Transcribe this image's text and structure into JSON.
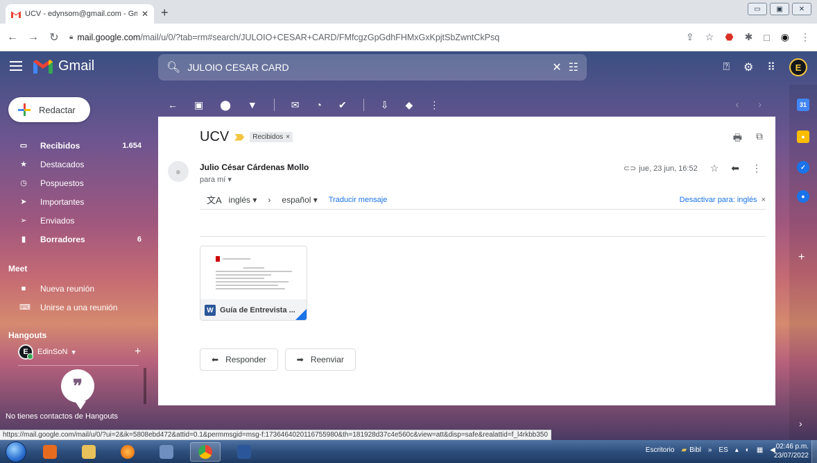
{
  "browser": {
    "tab_title": "UCV - edynsom@gmail.com - Gm",
    "url_host": "mail.google.com",
    "url_rest": "/mail/u/0/?tab=rm#search/JULOIO+CESAR+CARD/FMfcgzGpGdhFHMxGxKpjtSbZwntCkPsq",
    "status_url": "https://mail.google.com/mail/u/0/?ui=2&ik=5808ebd472&attid=0.1&permmsgid=msg-f:1736464020116755980&th=181928d37c4e560c&view=att&disp=safe&realattid=f_l4rkbb350"
  },
  "gmail": {
    "logo_text": "Gmail",
    "search_value": "JULOIO CESAR CARD",
    "compose_label": "Redactar",
    "nav": [
      {
        "icon": "inbox-icon",
        "label": "Recibidos",
        "count": "1.654",
        "bold": true
      },
      {
        "icon": "star-icon",
        "label": "Destacados",
        "count": "",
        "bold": false
      },
      {
        "icon": "clock-icon",
        "label": "Pospuestos",
        "count": "",
        "bold": false
      },
      {
        "icon": "important-icon",
        "label": "Importantes",
        "count": "",
        "bold": false
      },
      {
        "icon": "send-icon",
        "label": "Enviados",
        "count": "",
        "bold": false
      },
      {
        "icon": "draft-icon",
        "label": "Borradores",
        "count": "6",
        "bold": true
      }
    ],
    "meet": {
      "title": "Meet",
      "new_meeting": "Nueva reunión",
      "join_meeting": "Unirse a una reunión"
    },
    "hangouts": {
      "title": "Hangouts",
      "user": "EdinSoN",
      "no_contacts": "No tienes contactos de Hangouts"
    }
  },
  "message": {
    "subject": "UCV",
    "label": "Recibidos",
    "sender": "Julio César Cárdenas Mollo",
    "to": "para mí",
    "date": "jue, 23 jun, 16:52",
    "translate": {
      "from": "inglés",
      "to": "español",
      "action": "Traducir mensaje",
      "disable": "Desactivar para: inglés"
    },
    "attachment": "Guía de Entrevista ...",
    "reply": "Responder",
    "forward": "Reenviar"
  },
  "taskbar": {
    "desktop_label": "Escritorio",
    "bibl_label": "Bibl",
    "lang": "ES",
    "time": "02:46 p.m.",
    "date": "23/07/2022"
  },
  "colors": {
    "gmail_red": "#ea4335",
    "gmail_blue": "#4285f4",
    "gmail_yellow": "#fbbc04",
    "gmail_green": "#34a853",
    "link_blue": "#1a73e8"
  }
}
